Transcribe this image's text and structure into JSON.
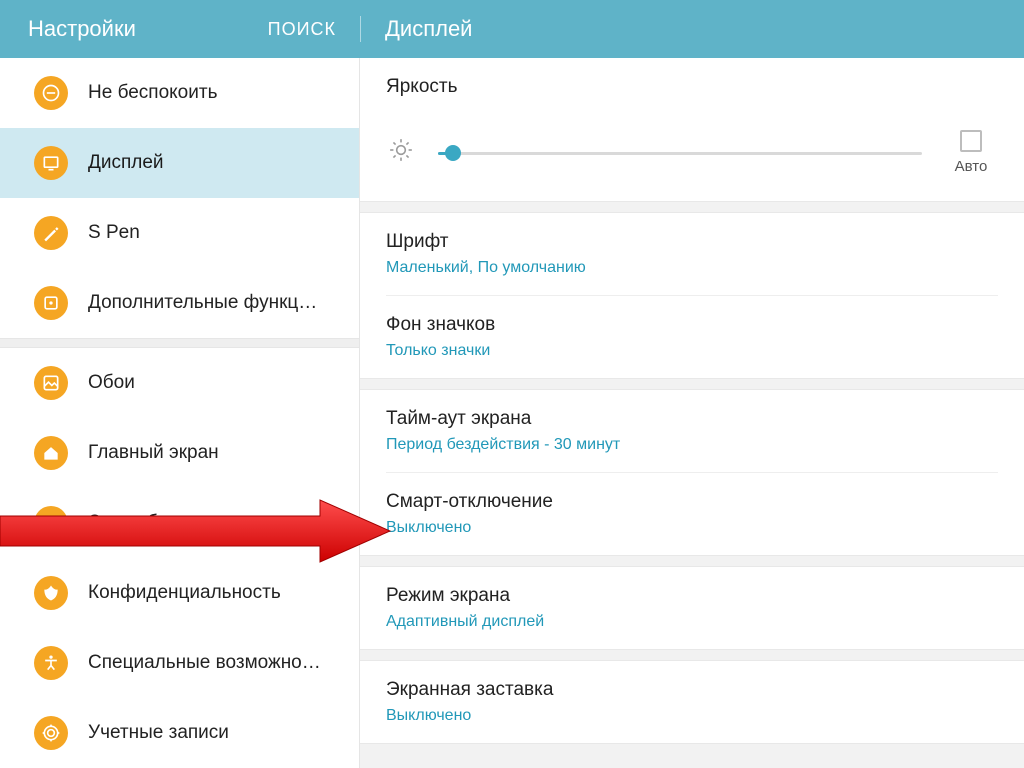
{
  "header": {
    "title": "Настройки",
    "search": "ПОИСК",
    "page": "Дисплей"
  },
  "sidebar": {
    "items": [
      {
        "label": "Не беспокоить",
        "icon": "dnd",
        "color": "#f5a623",
        "selected": false
      },
      {
        "label": "Дисплей",
        "icon": "display",
        "color": "#f5a623",
        "selected": true
      },
      {
        "label": "S Pen",
        "icon": "spen",
        "color": "#f5a623",
        "selected": false
      },
      {
        "label": "Дополнительные функц…",
        "icon": "advanced",
        "color": "#f5a623",
        "selected": false
      },
      {
        "label": "Обои",
        "icon": "wallpaper",
        "color": "#f5a623",
        "selected": false
      },
      {
        "label": "Главный экран",
        "icon": "home",
        "color": "#f5a623",
        "selected": false
      },
      {
        "label": "Экран блокировки и защ…",
        "icon": "lock",
        "color": "#f5a623",
        "selected": false
      },
      {
        "label": "Конфиденциальность",
        "icon": "privacy",
        "color": "#f5a623",
        "selected": false
      },
      {
        "label": "Специальные возможно…",
        "icon": "accessibility",
        "color": "#f5a623",
        "selected": false
      },
      {
        "label": "Учетные записи",
        "icon": "accounts",
        "color": "#f5a623",
        "selected": false
      }
    ]
  },
  "content": {
    "brightness": {
      "title": "Яркость",
      "auto": "Авто"
    },
    "font": {
      "title": "Шрифт",
      "sub": "Маленький, По умолчанию"
    },
    "iconbg": {
      "title": "Фон значков",
      "sub": "Только значки"
    },
    "timeout": {
      "title": "Тайм-аут экрана",
      "sub": "Период бездействия - 30 минут"
    },
    "smartstay": {
      "title": "Смарт-отключение",
      "sub": "Выключено"
    },
    "screenmode": {
      "title": "Режим экрана",
      "sub": "Адаптивный дисплей"
    },
    "screensaver": {
      "title": "Экранная заставка",
      "sub": "Выключено"
    }
  }
}
